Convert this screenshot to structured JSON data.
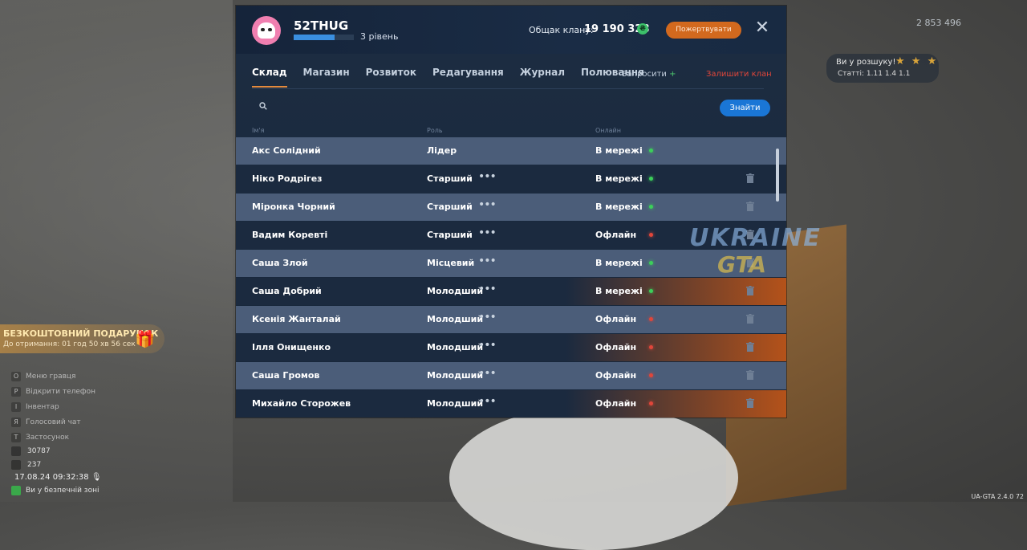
{
  "clan": {
    "name": "52THUG",
    "level_label": "3 рівень",
    "xp_progress": 0.68,
    "treasury_label": "Общак клану:",
    "treasury_value": "19 190 328",
    "currency_symbol": "₴",
    "donate_label": "Пожертвувати"
  },
  "tabs": [
    "Склад",
    "Магазин",
    "Розвиток",
    "Редагування",
    "Журнал",
    "Полювання"
  ],
  "active_tab": "Склад",
  "actions": {
    "invite_label": "Запросити",
    "invite_plus": "+",
    "leave_label": "Залишити клан"
  },
  "search": {
    "placeholder": "",
    "button_label": "Знайти"
  },
  "columns": {
    "name": "Ім'я",
    "role": "Роль",
    "online": "Онлайн"
  },
  "members": [
    {
      "name": "Акс Солідний",
      "role": "Лідер",
      "status": "В мережі",
      "online": true,
      "menu": false,
      "delete": false
    },
    {
      "name": "Ніко Родрігез",
      "role": "Старший",
      "status": "В мережі",
      "online": true,
      "menu": true,
      "delete": true
    },
    {
      "name": "Міронка Чорний",
      "role": "Старший",
      "status": "В мережі",
      "online": true,
      "menu": true,
      "delete": true
    },
    {
      "name": "Вадим Коревті",
      "role": "Старший",
      "status": "Офлайн",
      "online": false,
      "menu": true,
      "delete": true
    },
    {
      "name": "Саша Злой",
      "role": "Місцевий",
      "status": "В мережі",
      "online": true,
      "menu": true,
      "delete": true
    },
    {
      "name": "Саша Добрий",
      "role": "Молодший",
      "status": "В мережі",
      "online": true,
      "menu": true,
      "delete": true
    },
    {
      "name": "Ксенія Жанталай",
      "role": "Молодший",
      "status": "Офлайн",
      "online": false,
      "menu": true,
      "delete": true
    },
    {
      "name": "Ілля Онищенко",
      "role": "Молодший",
      "status": "Офлайн",
      "online": false,
      "menu": true,
      "delete": true
    },
    {
      "name": "Саша Громов",
      "role": "Молодший",
      "status": "Офлайн",
      "online": false,
      "menu": true,
      "delete": true
    },
    {
      "name": "Михайло Сторожев",
      "role": "Молодший",
      "status": "Офлайн",
      "online": false,
      "menu": true,
      "delete": true
    }
  ],
  "watermark": {
    "line1": "UKRAINE",
    "line2": "GTA"
  },
  "hud": {
    "gift_title": "БЕЗКОШТОВНИЙ ПОДАРУНОК",
    "gift_timer": "До отримання: 01 год 50 хв 56 сек",
    "menu_items": [
      {
        "key": "O",
        "label": "Меню гравця"
      },
      {
        "key": "P",
        "label": "Відкрити телефон"
      },
      {
        "key": "I",
        "label": "Інвентар"
      },
      {
        "key": "Я",
        "label": "Голосовий чат"
      },
      {
        "key": "T",
        "label": "Застосунок"
      }
    ],
    "player_id": "30787",
    "players_online": "237",
    "datetime": "17.08.24 09:32:38",
    "safe_zone": "Ви у безпечній зоні",
    "wanted_label": "Ви у розшуку!",
    "wanted_stars": "★ ★ ★",
    "wanted_articles": "Статті: 1.11 1.4  1.1",
    "money": "2 853 496",
    "version": "UA-GTA 2.4.0  72"
  },
  "colors": {
    "panel_bg": "#1d2d42",
    "row_light": "#4b5d79",
    "row_dark": "#1b2a3f",
    "accent_orange": "#d2691e",
    "accent_blue": "#1a76d6",
    "online_dot": "#3ccf5a",
    "offline_dot": "#e0463a",
    "leave_red": "#e0463a"
  }
}
